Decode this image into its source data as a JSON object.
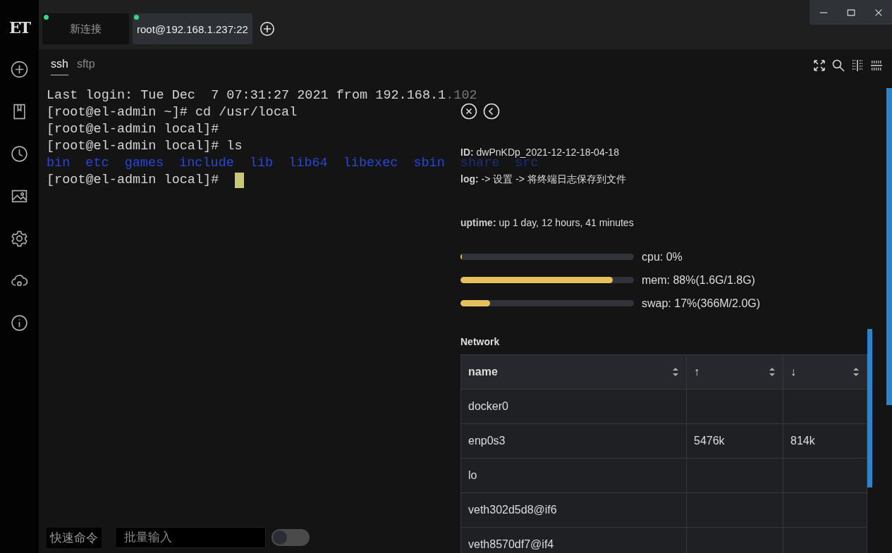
{
  "app": {
    "logo": "ET"
  },
  "sidebar": {
    "items": [
      {
        "kind": "add"
      },
      {
        "kind": "bookmark"
      },
      {
        "kind": "history"
      },
      {
        "kind": "image"
      },
      {
        "kind": "settings"
      },
      {
        "kind": "cloud"
      },
      {
        "kind": "info"
      }
    ]
  },
  "tabs": [
    {
      "label": "新连接",
      "selected": false,
      "connected": true
    },
    {
      "label": "root@192.168.1.237:22",
      "selected": true,
      "connected": true
    }
  ],
  "session_tabs": [
    {
      "label": "ssh",
      "selected": true
    },
    {
      "label": "sftp",
      "selected": false
    }
  ],
  "terminal": {
    "lines": [
      {
        "segments": [
          {
            "text": "Last login: Tue Dec  7 07:31:27 2021 from 192.168.1.102",
            "kind": "plain"
          }
        ]
      },
      {
        "segments": [
          {
            "text": "[root@el-admin ~]# cd /usr/local",
            "kind": "plain"
          }
        ]
      },
      {
        "segments": [
          {
            "text": "[root@el-admin local]#",
            "kind": "plain"
          }
        ]
      },
      {
        "segments": [
          {
            "text": "[root@el-admin local]# ls",
            "kind": "plain"
          }
        ]
      },
      {
        "segments": [
          {
            "text": "bin",
            "kind": "dir"
          },
          {
            "text": "etc",
            "kind": "dir"
          },
          {
            "text": "games",
            "kind": "dir"
          },
          {
            "text": "include",
            "kind": "dir"
          },
          {
            "text": "lib",
            "kind": "dir"
          },
          {
            "text": "lib64",
            "kind": "dir"
          },
          {
            "text": "libexec",
            "kind": "dir"
          },
          {
            "text": "sbin",
            "kind": "dir"
          },
          {
            "text": "share",
            "kind": "dir"
          },
          {
            "text": "src",
            "kind": "dir"
          }
        ]
      },
      {
        "segments": [
          {
            "text": "[root@el-admin local]# ",
            "kind": "plain"
          }
        ],
        "cursor": true
      }
    ]
  },
  "info_panel": {
    "id": "**ID:** dwPnKDp_2021-12-12-18-04-18",
    "log": "**log:** -> 设置 -> 将终端日志保存到文件",
    "uptime": "**uptime:** up 1 day, 12 hours, 41 minutes",
    "meters": [
      {
        "label": "cpu: 0%",
        "level": 0.01
      },
      {
        "label": "mem: 88%(1.6G/1.8G)",
        "level": 0.88
      },
      {
        "label": "swap: 17%(366M/2.0G)",
        "level": 0.17
      }
    ],
    "network": {
      "title": "Network",
      "columns": [
        "name",
        "↑",
        "↓"
      ],
      "rows": [
        {
          "name": "docker0"
        },
        {
          "name": "enp0s3",
          "up": "5476k",
          "down": "814k"
        },
        {
          "name": "lo"
        },
        {
          "name": "veth302d5d8@if6"
        },
        {
          "name": "veth8570df7@if4"
        }
      ]
    }
  },
  "bottom_bar": {
    "quick_commands": "快速命令",
    "batch_input": {
      "placeholder": "批量输入"
    },
    "toggle": {
      "on": false
    }
  }
}
